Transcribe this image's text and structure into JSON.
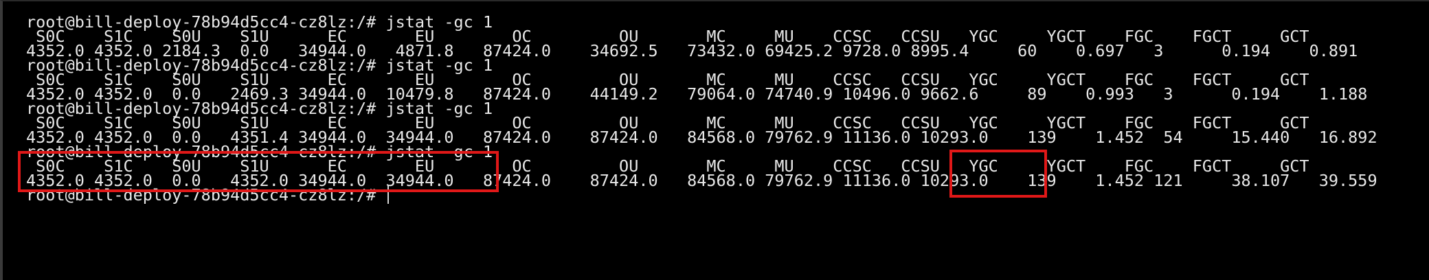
{
  "terminal": {
    "lines": [
      "root@bill-deploy-78b94d5cc4-cz8lz:/# jstat -gc 1",
      " S0C    S1C    S0U    S1U      EC       EU        OC         OU       MC     MU    CCSC   CCSU   YGC     YGCT    FGC    FGCT     GCT",
      "4352.0 4352.0 2184.3  0.0   34944.0   4871.8   87424.0    34692.5   73432.0 69425.2 9728.0 8995.4     60    0.697   3      0.194    0.891",
      "root@bill-deploy-78b94d5cc4-cz8lz:/# jstat -gc 1",
      " S0C    S1C    S0U    S1U      EC       EU        OC         OU       MC     MU    CCSC   CCSU   YGC     YGCT    FGC    FGCT     GCT",
      "4352.0 4352.0  0.0   2469.3 34944.0  10479.8   87424.0    44149.2   79064.0 74740.9 10496.0 9662.6     89    0.993   3      0.194    1.188",
      "root@bill-deploy-78b94d5cc4-cz8lz:/# jstat -gc 1",
      " S0C    S1C    S0U    S1U      EC       EU        OC         OU       MC     MU    CCSC   CCSU   YGC     YGCT    FGC    FGCT     GCT",
      "4352.0 4352.0  0.0   4351.4 34944.0  34944.0   87424.0    87424.0   84568.0 79762.9 11136.0 10293.0    139    1.452  54     15.440   16.892",
      "root@bill-deploy-78b94d5cc4-cz8lz:/# jstat -gc 1",
      " S0C    S1C    S0U    S1U      EC       EU        OC         OU       MC     MU    CCSC   CCSU   YGC     YGCT    FGC    FGCT     GCT",
      "4352.0 4352.0  0.0   4352.0 34944.0  34944.0   87424.0    87424.0   84568.0 79762.9 11136.0 10293.0    139    1.452 121     38.107   39.559",
      "root@bill-deploy-78b94d5cc4-cz8lz:/# "
    ]
  },
  "annotations": {
    "box_color": "#e01818"
  }
}
